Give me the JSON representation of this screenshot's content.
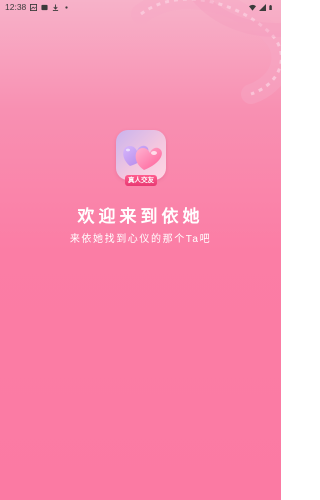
{
  "status_bar": {
    "time": "12:38"
  },
  "app": {
    "logo_badge": "真人交友",
    "title": "欢迎来到依她",
    "subtitle": "来依她找到心仪的那个Ta吧"
  }
}
